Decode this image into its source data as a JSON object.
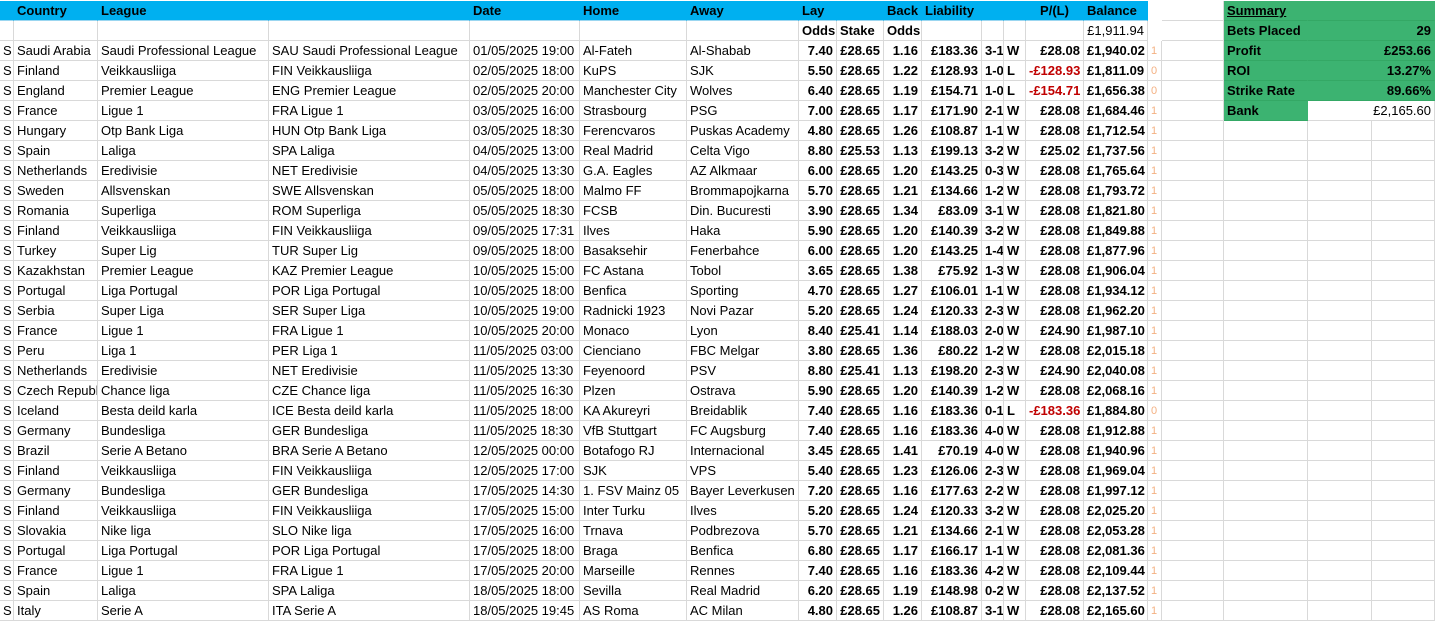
{
  "headers": {
    "country": "Country",
    "league": "League",
    "date": "Date",
    "home": "Home",
    "away": "Away",
    "lay": "Lay",
    "back": "Back",
    "liability": "Liability",
    "pl": "P/(L)",
    "balance": "Balance",
    "lay_sub": "Odds",
    "stake_sub": "Stake",
    "back_sub": "Odds",
    "start_balance": "£1,911.94"
  },
  "rows": [
    {
      "s": "S",
      "country": "Saudi Arabia",
      "league": "Saudi Professional League",
      "code": "SAU Saudi Professional League",
      "date": "01/05/2025 19:00",
      "home": "Al-Fateh",
      "away": "Al-Shabab",
      "lay": "7.40",
      "stake": "£28.65",
      "back": "1.16",
      "liab": "£183.36",
      "score": "3-1",
      "res": "W",
      "pl": "£28.08",
      "bal": "£1,940.02",
      "f": "1"
    },
    {
      "s": "S",
      "country": "Finland",
      "league": "Veikkausliiga",
      "code": "FIN Veikkausliiga",
      "date": "02/05/2025 18:00",
      "home": "KuPS",
      "away": "SJK",
      "lay": "5.50",
      "stake": "£28.65",
      "back": "1.22",
      "liab": "£128.93",
      "score": "1-0",
      "res": "L",
      "pl": "-£128.93",
      "bal": "£1,811.09",
      "f": "0",
      "neg": true
    },
    {
      "s": "S",
      "country": "England",
      "league": "Premier League",
      "code": "ENG Premier League",
      "date": "02/05/2025 20:00",
      "home": "Manchester City",
      "away": "Wolves",
      "lay": "6.40",
      "stake": "£28.65",
      "back": "1.19",
      "liab": "£154.71",
      "score": "1-0",
      "res": "L",
      "pl": "-£154.71",
      "bal": "£1,656.38",
      "f": "0",
      "neg": true
    },
    {
      "s": "S",
      "country": "France",
      "league": "Ligue 1",
      "code": "FRA Ligue 1",
      "date": "03/05/2025 16:00",
      "home": "Strasbourg",
      "away": "PSG",
      "lay": "7.00",
      "stake": "£28.65",
      "back": "1.17",
      "liab": "£171.90",
      "score": "2-1",
      "res": "W",
      "pl": "£28.08",
      "bal": "£1,684.46",
      "f": "1"
    },
    {
      "s": "S",
      "country": "Hungary",
      "league": "Otp Bank Liga",
      "code": "HUN Otp Bank Liga",
      "date": "03/05/2025 18:30",
      "home": "Ferencvaros",
      "away": "Puskas Academy",
      "lay": "4.80",
      "stake": "£28.65",
      "back": "1.26",
      "liab": "£108.87",
      "score": "1-1",
      "res": "W",
      "pl": "£28.08",
      "bal": "£1,712.54",
      "f": "1"
    },
    {
      "s": "S",
      "country": "Spain",
      "league": "Laliga",
      "code": "SPA Laliga",
      "date": "04/05/2025 13:00",
      "home": "Real Madrid",
      "away": "Celta Vigo",
      "lay": "8.80",
      "stake": "£25.53",
      "back": "1.13",
      "liab": "£199.13",
      "score": "3-2",
      "res": "W",
      "pl": "£25.02",
      "bal": "£1,737.56",
      "f": "1"
    },
    {
      "s": "S",
      "country": "Netherlands",
      "league": "Eredivisie",
      "code": "NET Eredivisie",
      "date": "04/05/2025 13:30",
      "home": "G.A. Eagles",
      "away": "AZ Alkmaar",
      "lay": "6.00",
      "stake": "£28.65",
      "back": "1.20",
      "liab": "£143.25",
      "score": "0-3",
      "res": "W",
      "pl": "£28.08",
      "bal": "£1,765.64",
      "f": "1"
    },
    {
      "s": "S",
      "country": "Sweden",
      "league": "Allsvenskan",
      "code": "SWE Allsvenskan",
      "date": "05/05/2025 18:00",
      "home": "Malmo FF",
      "away": "Brommapojkarna",
      "lay": "5.70",
      "stake": "£28.65",
      "back": "1.21",
      "liab": "£134.66",
      "score": "1-2",
      "res": "W",
      "pl": "£28.08",
      "bal": "£1,793.72",
      "f": "1"
    },
    {
      "s": "S",
      "country": "Romania",
      "league": "Superliga",
      "code": "ROM Superliga",
      "date": "05/05/2025 18:30",
      "home": "FCSB",
      "away": "Din. Bucuresti",
      "lay": "3.90",
      "stake": "£28.65",
      "back": "1.34",
      "liab": "£83.09",
      "score": "3-1",
      "res": "W",
      "pl": "£28.08",
      "bal": "£1,821.80",
      "f": "1"
    },
    {
      "s": "S",
      "country": "Finland",
      "league": "Veikkausliiga",
      "code": "FIN Veikkausliiga",
      "date": "09/05/2025 17:31",
      "home": "Ilves",
      "away": "Haka",
      "lay": "5.90",
      "stake": "£28.65",
      "back": "1.20",
      "liab": "£140.39",
      "score": "3-2",
      "res": "W",
      "pl": "£28.08",
      "bal": "£1,849.88",
      "f": "1"
    },
    {
      "s": "S",
      "country": "Turkey",
      "league": "Super Lig",
      "code": "TUR Super Lig",
      "date": "09/05/2025 18:00",
      "home": "Basaksehir",
      "away": "Fenerbahce",
      "lay": "6.00",
      "stake": "£28.65",
      "back": "1.20",
      "liab": "£143.25",
      "score": "1-4",
      "res": "W",
      "pl": "£28.08",
      "bal": "£1,877.96",
      "f": "1"
    },
    {
      "s": "S",
      "country": "Kazakhstan",
      "league": "Premier League",
      "code": "KAZ Premier League",
      "date": "10/05/2025 15:00",
      "home": "FC Astana",
      "away": "Tobol",
      "lay": "3.65",
      "stake": "£28.65",
      "back": "1.38",
      "liab": "£75.92",
      "score": "1-3",
      "res": "W",
      "pl": "£28.08",
      "bal": "£1,906.04",
      "f": "1"
    },
    {
      "s": "S",
      "country": "Portugal",
      "league": "Liga Portugal",
      "code": "POR Liga Portugal",
      "date": "10/05/2025 18:00",
      "home": "Benfica",
      "away": "Sporting",
      "lay": "4.70",
      "stake": "£28.65",
      "back": "1.27",
      "liab": "£106.01",
      "score": "1-1",
      "res": "W",
      "pl": "£28.08",
      "bal": "£1,934.12",
      "f": "1"
    },
    {
      "s": "S",
      "country": "Serbia",
      "league": "Super Liga",
      "code": "SER Super Liga",
      "date": "10/05/2025 19:00",
      "home": "Radnicki 1923",
      "away": "Novi Pazar",
      "lay": "5.20",
      "stake": "£28.65",
      "back": "1.24",
      "liab": "£120.33",
      "score": "2-3",
      "res": "W",
      "pl": "£28.08",
      "bal": "£1,962.20",
      "f": "1"
    },
    {
      "s": "S",
      "country": "France",
      "league": "Ligue 1",
      "code": "FRA Ligue 1",
      "date": "10/05/2025 20:00",
      "home": "Monaco",
      "away": "Lyon",
      "lay": "8.40",
      "stake": "£25.41",
      "back": "1.14",
      "liab": "£188.03",
      "score": "2-0",
      "res": "W",
      "pl": "£24.90",
      "bal": "£1,987.10",
      "f": "1"
    },
    {
      "s": "S",
      "country": "Peru",
      "league": "Liga 1",
      "code": "PER Liga 1",
      "date": "11/05/2025 03:00",
      "home": "Cienciano",
      "away": "FBC Melgar",
      "lay": "3.80",
      "stake": "£28.65",
      "back": "1.36",
      "liab": "£80.22",
      "score": "1-2",
      "res": "W",
      "pl": "£28.08",
      "bal": "£2,015.18",
      "f": "1"
    },
    {
      "s": "S",
      "country": "Netherlands",
      "league": "Eredivisie",
      "code": "NET Eredivisie",
      "date": "11/05/2025 13:30",
      "home": "Feyenoord",
      "away": "PSV",
      "lay": "8.80",
      "stake": "£25.41",
      "back": "1.13",
      "liab": "£198.20",
      "score": "2-3",
      "res": "W",
      "pl": "£24.90",
      "bal": "£2,040.08",
      "f": "1"
    },
    {
      "s": "S",
      "country": "Czech Republ",
      "league": "Chance liga",
      "code": "CZE Chance liga",
      "date": "11/05/2025 16:30",
      "home": "Plzen",
      "away": "Ostrava",
      "lay": "5.90",
      "stake": "£28.65",
      "back": "1.20",
      "liab": "£140.39",
      "score": "1-2",
      "res": "W",
      "pl": "£28.08",
      "bal": "£2,068.16",
      "f": "1"
    },
    {
      "s": "S",
      "country": "Iceland",
      "league": "Besta deild karla",
      "code": "ICE Besta deild karla",
      "date": "11/05/2025 18:00",
      "home": "KA Akureyri",
      "away": "Breidablik",
      "lay": "7.40",
      "stake": "£28.65",
      "back": "1.16",
      "liab": "£183.36",
      "score": "0-1",
      "res": "L",
      "pl": "-£183.36",
      "bal": "£1,884.80",
      "f": "0",
      "neg": true
    },
    {
      "s": "S",
      "country": "Germany",
      "league": "Bundesliga",
      "code": "GER Bundesliga",
      "date": "11/05/2025 18:30",
      "home": "VfB Stuttgart",
      "away": "FC Augsburg",
      "lay": "7.40",
      "stake": "£28.65",
      "back": "1.16",
      "liab": "£183.36",
      "score": "4-0",
      "res": "W",
      "pl": "£28.08",
      "bal": "£1,912.88",
      "f": "1"
    },
    {
      "s": "S",
      "country": "Brazil",
      "league": "Serie A Betano",
      "code": "BRA Serie A Betano",
      "date": "12/05/2025 00:00",
      "home": "Botafogo RJ",
      "away": "Internacional",
      "lay": "3.45",
      "stake": "£28.65",
      "back": "1.41",
      "liab": "£70.19",
      "score": "4-0",
      "res": "W",
      "pl": "£28.08",
      "bal": "£1,940.96",
      "f": "1"
    },
    {
      "s": "S",
      "country": "Finland",
      "league": "Veikkausliiga",
      "code": "FIN Veikkausliiga",
      "date": "12/05/2025 17:00",
      "home": "SJK",
      "away": "VPS",
      "lay": "5.40",
      "stake": "£28.65",
      "back": "1.23",
      "liab": "£126.06",
      "score": "2-3",
      "res": "W",
      "pl": "£28.08",
      "bal": "£1,969.04",
      "f": "1"
    },
    {
      "s": "S",
      "country": "Germany",
      "league": "Bundesliga",
      "code": "GER Bundesliga",
      "date": "17/05/2025 14:30",
      "home": "1. FSV Mainz 05",
      "away": "Bayer Leverkusen",
      "lay": "7.20",
      "stake": "£28.65",
      "back": "1.16",
      "liab": "£177.63",
      "score": "2-2",
      "res": "W",
      "pl": "£28.08",
      "bal": "£1,997.12",
      "f": "1"
    },
    {
      "s": "S",
      "country": "Finland",
      "league": "Veikkausliiga",
      "code": "FIN Veikkausliiga",
      "date": "17/05/2025 15:00",
      "home": "Inter Turku",
      "away": "Ilves",
      "lay": "5.20",
      "stake": "£28.65",
      "back": "1.24",
      "liab": "£120.33",
      "score": "3-2",
      "res": "W",
      "pl": "£28.08",
      "bal": "£2,025.20",
      "f": "1"
    },
    {
      "s": "S",
      "country": "Slovakia",
      "league": "Nike liga",
      "code": "SLO Nike liga",
      "date": "17/05/2025 16:00",
      "home": "Trnava",
      "away": "Podbrezova",
      "lay": "5.70",
      "stake": "£28.65",
      "back": "1.21",
      "liab": "£134.66",
      "score": "2-1",
      "res": "W",
      "pl": "£28.08",
      "bal": "£2,053.28",
      "f": "1"
    },
    {
      "s": "S",
      "country": "Portugal",
      "league": "Liga Portugal",
      "code": "POR Liga Portugal",
      "date": "17/05/2025 18:00",
      "home": "Braga",
      "away": "Benfica",
      "lay": "6.80",
      "stake": "£28.65",
      "back": "1.17",
      "liab": "£166.17",
      "score": "1-1",
      "res": "W",
      "pl": "£28.08",
      "bal": "£2,081.36",
      "f": "1"
    },
    {
      "s": "S",
      "country": "France",
      "league": "Ligue 1",
      "code": "FRA Ligue 1",
      "date": "17/05/2025 20:00",
      "home": "Marseille",
      "away": "Rennes",
      "lay": "7.40",
      "stake": "£28.65",
      "back": "1.16",
      "liab": "£183.36",
      "score": "4-2",
      "res": "W",
      "pl": "£28.08",
      "bal": "£2,109.44",
      "f": "1"
    },
    {
      "s": "S",
      "country": "Spain",
      "league": "Laliga",
      "code": "SPA Laliga",
      "date": "18/05/2025 18:00",
      "home": "Sevilla",
      "away": "Real Madrid",
      "lay": "6.20",
      "stake": "£28.65",
      "back": "1.19",
      "liab": "£148.98",
      "score": "0-2",
      "res": "W",
      "pl": "£28.08",
      "bal": "£2,137.52",
      "f": "1"
    },
    {
      "s": "S",
      "country": "Italy",
      "league": "Serie A",
      "code": "ITA Serie A",
      "date": "18/05/2025 19:45",
      "home": "AS Roma",
      "away": "AC Milan",
      "lay": "4.80",
      "stake": "£28.65",
      "back": "1.26",
      "liab": "£108.87",
      "score": "3-1",
      "res": "W",
      "pl": "£28.08",
      "bal": "£2,165.60",
      "f": "1"
    }
  ],
  "summary": {
    "title": "Summary",
    "items": [
      {
        "label": "Bets Placed",
        "value": "29"
      },
      {
        "label": "Profit",
        "value": "£253.66"
      },
      {
        "label": "ROI",
        "value": "13.27%"
      },
      {
        "label": "Strike Rate",
        "value": "89.66%"
      }
    ],
    "bank_label": "Bank",
    "bank_value": "£2,165.60"
  },
  "colors": {
    "header_bg": "#00b0f0",
    "summary_bg": "#3cb371",
    "negative": "#c00000",
    "flag": "#f4b183"
  }
}
